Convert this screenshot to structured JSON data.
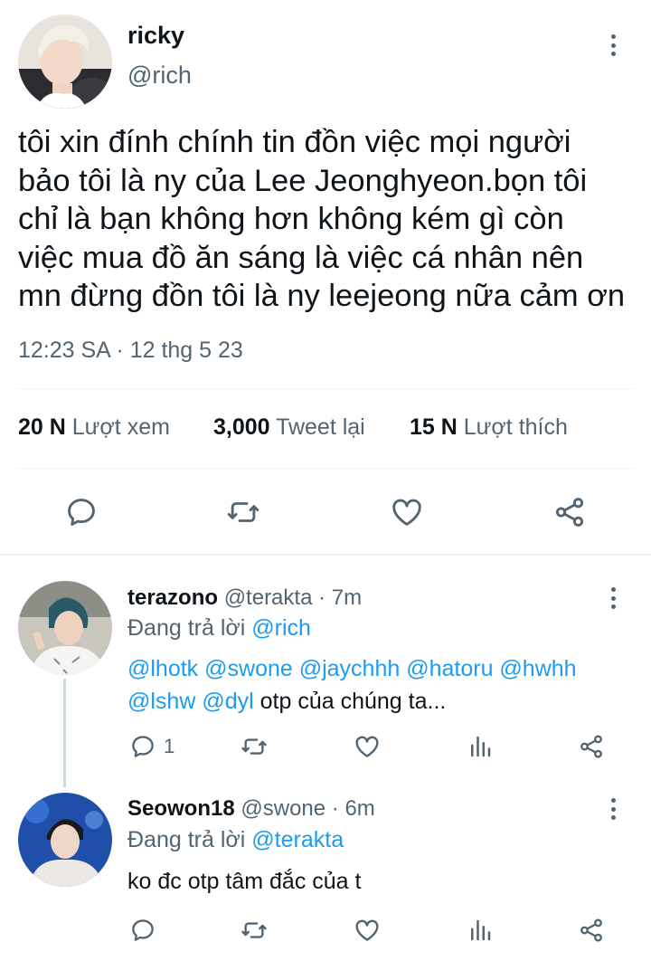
{
  "main_tweet": {
    "name": "ricky",
    "handle": "@rich",
    "text_lines": [
      "tôi xin đính chính tin đồn việc mọi người",
      "bảo tôi là ny của Lee Jeonghyeon.bọn tôi",
      "chỉ là bạn không hơn không kém gì còn",
      "việc mua đồ ăn sáng là việc cá nhân nên",
      "mn đừng đồn tôi là ny leejeong nữa cảm ơn"
    ],
    "timestamp": "12:23 SA · 12 thg 5 23",
    "stats": {
      "views_count": "20 N",
      "views_label": "Lượt xem",
      "retweets_count": "3,000",
      "retweets_label": "Tweet lại",
      "likes_count": "15 N",
      "likes_label": "Lượt thích"
    }
  },
  "replies": [
    {
      "name": "terazono",
      "handle_time": "@terakta · 7m",
      "replying_prefix": "Đang trả lời",
      "replying_to": "@rich",
      "line1": "@lhotk @swone @jaychhh @hatoru @hwhh",
      "line2_links": "@lshw @dyl",
      "line2_text": " otp của chúng ta...",
      "reply_count": "1"
    },
    {
      "name": "Seowon18",
      "handle_time": "@swone · 6m",
      "replying_prefix": "Đang trả lời",
      "replying_to": "@terakta",
      "text": "ko đc otp tâm đắc của t"
    }
  ],
  "colors": {
    "link": "#1d9bf0",
    "muted": "#536471",
    "text": "#0f1419",
    "divider": "#eff3f4"
  }
}
